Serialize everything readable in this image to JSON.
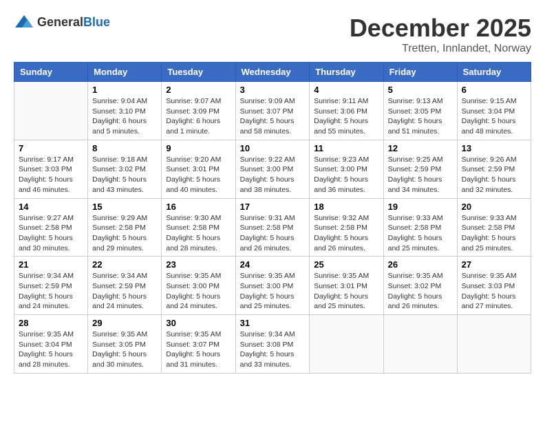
{
  "header": {
    "logo_general": "General",
    "logo_blue": "Blue",
    "month": "December 2025",
    "location": "Tretten, Innlandet, Norway"
  },
  "days_of_week": [
    "Sunday",
    "Monday",
    "Tuesday",
    "Wednesday",
    "Thursday",
    "Friday",
    "Saturday"
  ],
  "weeks": [
    [
      {
        "num": "",
        "detail": ""
      },
      {
        "num": "1",
        "detail": "Sunrise: 9:04 AM\nSunset: 3:10 PM\nDaylight: 6 hours\nand 5 minutes."
      },
      {
        "num": "2",
        "detail": "Sunrise: 9:07 AM\nSunset: 3:09 PM\nDaylight: 6 hours\nand 1 minute."
      },
      {
        "num": "3",
        "detail": "Sunrise: 9:09 AM\nSunset: 3:07 PM\nDaylight: 5 hours\nand 58 minutes."
      },
      {
        "num": "4",
        "detail": "Sunrise: 9:11 AM\nSunset: 3:06 PM\nDaylight: 5 hours\nand 55 minutes."
      },
      {
        "num": "5",
        "detail": "Sunrise: 9:13 AM\nSunset: 3:05 PM\nDaylight: 5 hours\nand 51 minutes."
      },
      {
        "num": "6",
        "detail": "Sunrise: 9:15 AM\nSunset: 3:04 PM\nDaylight: 5 hours\nand 48 minutes."
      }
    ],
    [
      {
        "num": "7",
        "detail": "Sunrise: 9:17 AM\nSunset: 3:03 PM\nDaylight: 5 hours\nand 46 minutes."
      },
      {
        "num": "8",
        "detail": "Sunrise: 9:18 AM\nSunset: 3:02 PM\nDaylight: 5 hours\nand 43 minutes."
      },
      {
        "num": "9",
        "detail": "Sunrise: 9:20 AM\nSunset: 3:01 PM\nDaylight: 5 hours\nand 40 minutes."
      },
      {
        "num": "10",
        "detail": "Sunrise: 9:22 AM\nSunset: 3:00 PM\nDaylight: 5 hours\nand 38 minutes."
      },
      {
        "num": "11",
        "detail": "Sunrise: 9:23 AM\nSunset: 3:00 PM\nDaylight: 5 hours\nand 36 minutes."
      },
      {
        "num": "12",
        "detail": "Sunrise: 9:25 AM\nSunset: 2:59 PM\nDaylight: 5 hours\nand 34 minutes."
      },
      {
        "num": "13",
        "detail": "Sunrise: 9:26 AM\nSunset: 2:59 PM\nDaylight: 5 hours\nand 32 minutes."
      }
    ],
    [
      {
        "num": "14",
        "detail": "Sunrise: 9:27 AM\nSunset: 2:58 PM\nDaylight: 5 hours\nand 30 minutes."
      },
      {
        "num": "15",
        "detail": "Sunrise: 9:29 AM\nSunset: 2:58 PM\nDaylight: 5 hours\nand 29 minutes."
      },
      {
        "num": "16",
        "detail": "Sunrise: 9:30 AM\nSunset: 2:58 PM\nDaylight: 5 hours\nand 28 minutes."
      },
      {
        "num": "17",
        "detail": "Sunrise: 9:31 AM\nSunset: 2:58 PM\nDaylight: 5 hours\nand 26 minutes."
      },
      {
        "num": "18",
        "detail": "Sunrise: 9:32 AM\nSunset: 2:58 PM\nDaylight: 5 hours\nand 26 minutes."
      },
      {
        "num": "19",
        "detail": "Sunrise: 9:33 AM\nSunset: 2:58 PM\nDaylight: 5 hours\nand 25 minutes."
      },
      {
        "num": "20",
        "detail": "Sunrise: 9:33 AM\nSunset: 2:58 PM\nDaylight: 5 hours\nand 25 minutes."
      }
    ],
    [
      {
        "num": "21",
        "detail": "Sunrise: 9:34 AM\nSunset: 2:59 PM\nDaylight: 5 hours\nand 24 minutes."
      },
      {
        "num": "22",
        "detail": "Sunrise: 9:34 AM\nSunset: 2:59 PM\nDaylight: 5 hours\nand 24 minutes."
      },
      {
        "num": "23",
        "detail": "Sunrise: 9:35 AM\nSunset: 3:00 PM\nDaylight: 5 hours\nand 24 minutes."
      },
      {
        "num": "24",
        "detail": "Sunrise: 9:35 AM\nSunset: 3:00 PM\nDaylight: 5 hours\nand 25 minutes."
      },
      {
        "num": "25",
        "detail": "Sunrise: 9:35 AM\nSunset: 3:01 PM\nDaylight: 5 hours\nand 25 minutes."
      },
      {
        "num": "26",
        "detail": "Sunrise: 9:35 AM\nSunset: 3:02 PM\nDaylight: 5 hours\nand 26 minutes."
      },
      {
        "num": "27",
        "detail": "Sunrise: 9:35 AM\nSunset: 3:03 PM\nDaylight: 5 hours\nand 27 minutes."
      }
    ],
    [
      {
        "num": "28",
        "detail": "Sunrise: 9:35 AM\nSunset: 3:04 PM\nDaylight: 5 hours\nand 28 minutes."
      },
      {
        "num": "29",
        "detail": "Sunrise: 9:35 AM\nSunset: 3:05 PM\nDaylight: 5 hours\nand 30 minutes."
      },
      {
        "num": "30",
        "detail": "Sunrise: 9:35 AM\nSunset: 3:07 PM\nDaylight: 5 hours\nand 31 minutes."
      },
      {
        "num": "31",
        "detail": "Sunrise: 9:34 AM\nSunset: 3:08 PM\nDaylight: 5 hours\nand 33 minutes."
      },
      {
        "num": "",
        "detail": ""
      },
      {
        "num": "",
        "detail": ""
      },
      {
        "num": "",
        "detail": ""
      }
    ]
  ]
}
